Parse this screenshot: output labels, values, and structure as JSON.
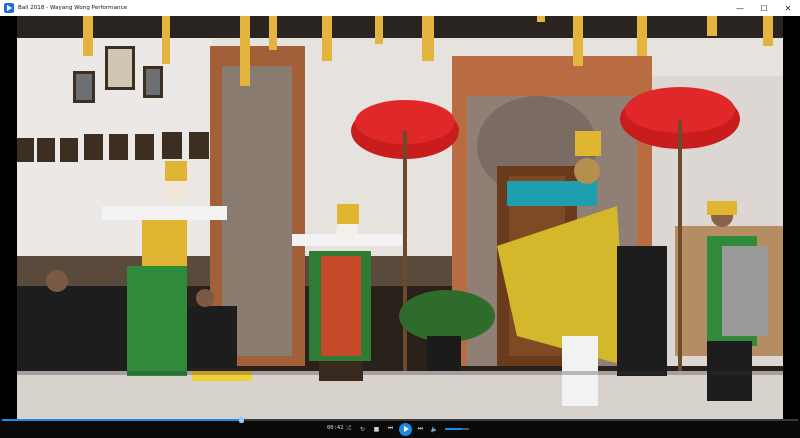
{
  "window": {
    "title": "Bali 2018 - Wayang Wong Performance",
    "controls": {
      "minimize": "—",
      "maximize": "☐",
      "close": "✕"
    }
  },
  "player": {
    "time": "00:42",
    "progress_fraction": 0.3,
    "volume_fraction": 0.7,
    "buttons": {
      "shuffle": "⤮",
      "repeat": "↻",
      "stop": "■",
      "previous": "⏮",
      "next": "⏭",
      "mute": "🔈"
    }
  },
  "scene": {
    "colors": {
      "wall": "#e8e4e0",
      "brick": "#b56a3e",
      "stone": "#8d7f74",
      "floor": "#d9d3ce",
      "umbrella": "#d21f1f",
      "gold": "#e0b531",
      "green": "#2f8a3a"
    }
  }
}
